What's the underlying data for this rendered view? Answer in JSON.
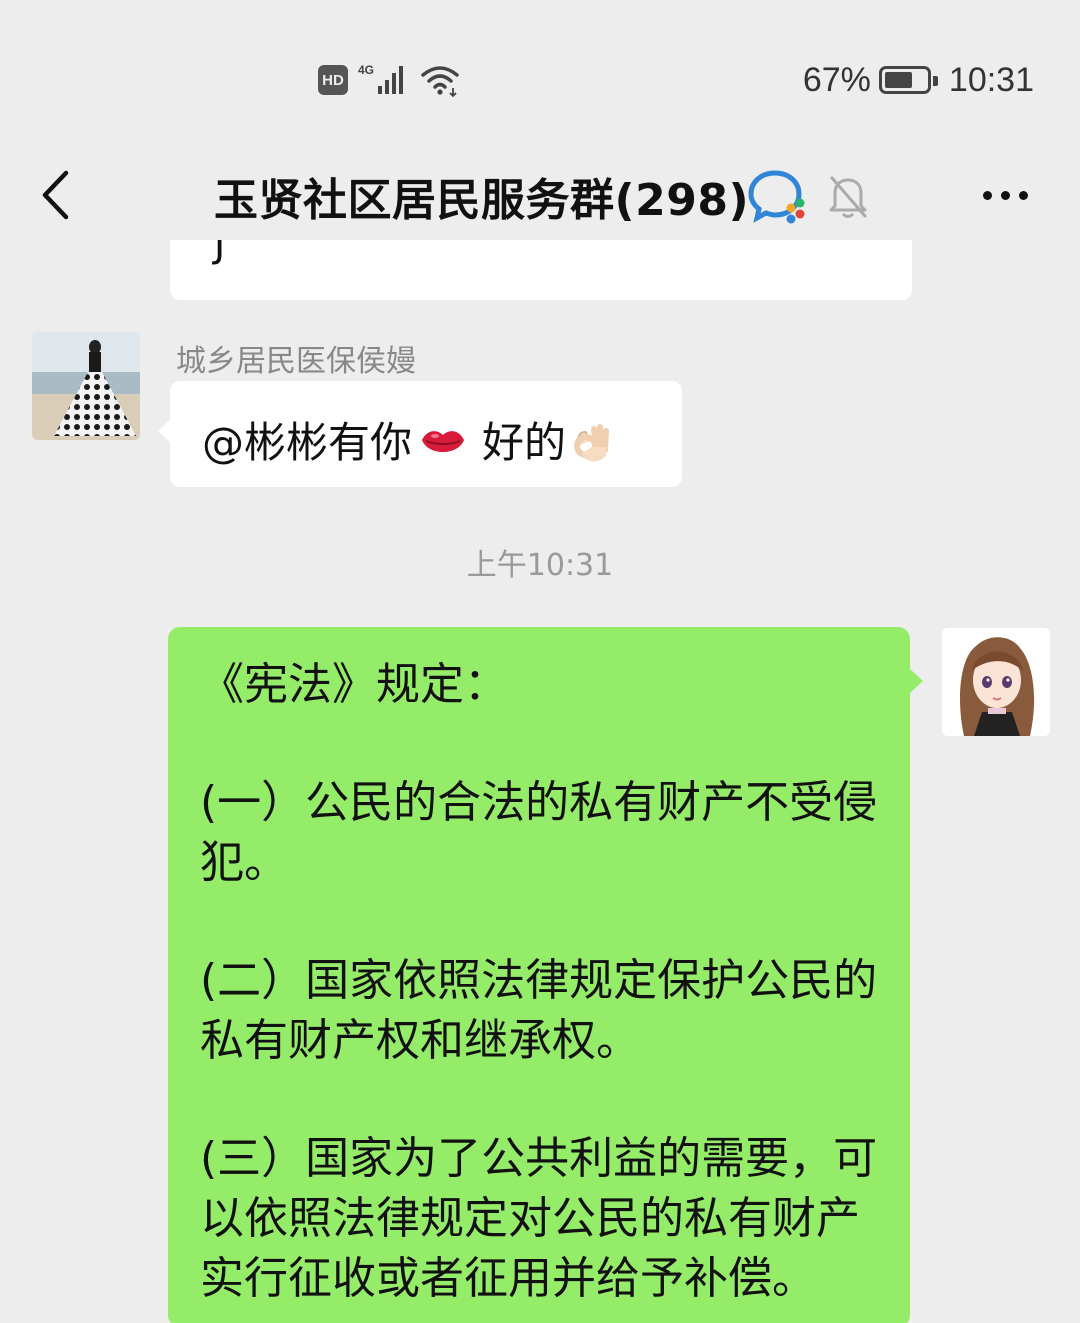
{
  "status_bar": {
    "network": "4G",
    "hd_label": "HD",
    "battery_percent": "67%",
    "battery_level": 0.67,
    "time": "10:31"
  },
  "nav": {
    "title": "玉贤社区居民服务群(298)",
    "icons": [
      "back-arrow-icon",
      "wecom-chat-icon",
      "mute-bell-icon",
      "more-icon"
    ]
  },
  "chat": {
    "previous_fragment": "J",
    "messages": [
      {
        "sender": "城乡居民医保侯嫚",
        "text_before": "@彬彬有你",
        "emoji_1": "lips-emoji",
        "text_after": "好的",
        "emoji_2": "ok-hand-emoji"
      }
    ],
    "timestamp": "上午10:31",
    "my_message": {
      "paragraphs": [
        "《宪法》规定：",
        "(一）公民的合法的私有财产不受侵犯。",
        "(二）国家依照法律规定保护公民的私有财产权和继承权。",
        "(三）国家为了公共利益的需要，可以依照法律规定对公民的私有财产实行征收或者征用并给予补偿。"
      ]
    }
  },
  "colors": {
    "background": "#ededed",
    "my_bubble": "#95ec69",
    "other_bubble": "#ffffff"
  }
}
